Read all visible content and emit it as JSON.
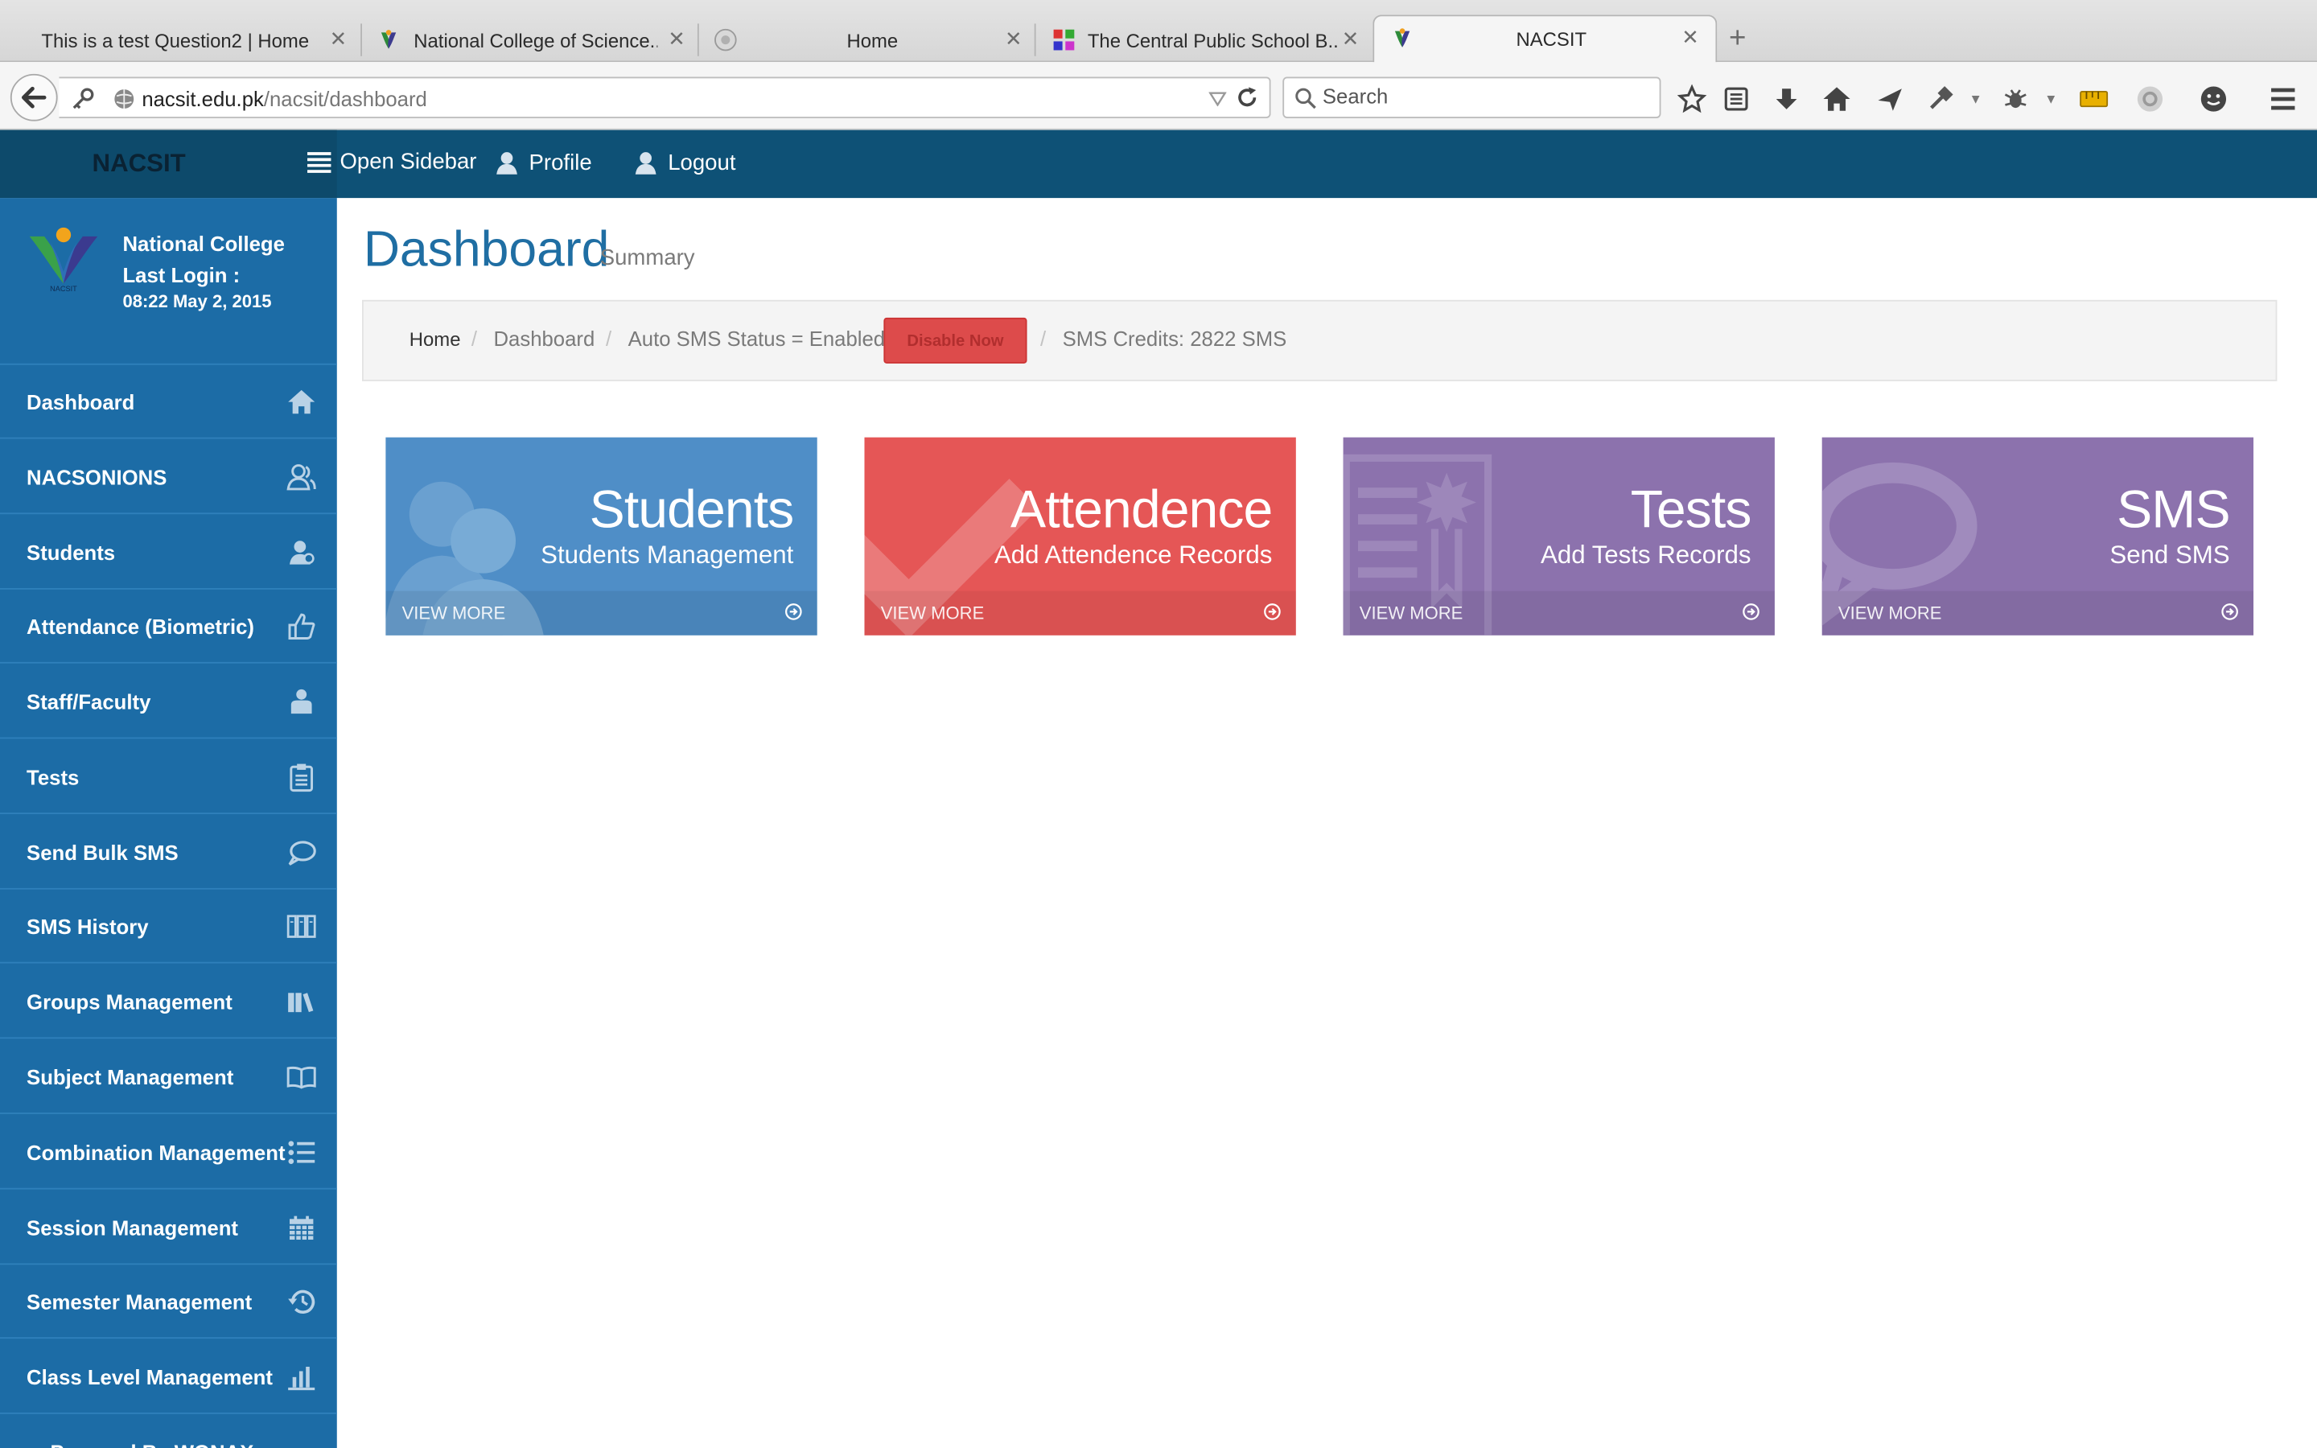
{
  "browser": {
    "tabs": [
      {
        "title": "This is a test Question2 | Home ..."
      },
      {
        "title": "National College of Science..."
      },
      {
        "title": "Home"
      },
      {
        "title": "The Central Public School B..."
      },
      {
        "title": "NACSIT"
      }
    ],
    "url_domain": "nacsit.edu.pk",
    "url_path": "/nacsit/dashboard",
    "search_placeholder": "Search"
  },
  "header": {
    "brand": "NACSIT",
    "nav": [
      {
        "label": "Open Sidebar",
        "icon": "menu-icon"
      },
      {
        "label": "Profile",
        "icon": "user-icon"
      },
      {
        "label": "Logout",
        "icon": "user-logout-icon"
      }
    ]
  },
  "sidebar": {
    "profile": {
      "name": "National College",
      "last_login_label": "Last Login :",
      "last_login_time": "08:22 May 2, 2015"
    },
    "items": [
      {
        "label": "Dashboard",
        "icon": "home-icon"
      },
      {
        "label": "NACSONIONS",
        "icon": "users-icon"
      },
      {
        "label": "Students",
        "icon": "student-icon"
      },
      {
        "label": "Attendance (Biometric)",
        "icon": "thumbs-up-icon"
      },
      {
        "label": "Staff/Faculty",
        "icon": "staff-icon"
      },
      {
        "label": "Tests",
        "icon": "clipboard-icon"
      },
      {
        "label": "Send Bulk SMS",
        "icon": "chat-bubble-icon"
      },
      {
        "label": "SMS History",
        "icon": "columns-icon"
      },
      {
        "label": "Groups Management",
        "icon": "books-icon"
      },
      {
        "label": "Subject Management",
        "icon": "open-book-icon"
      },
      {
        "label": "Combination Management",
        "icon": "list-icon"
      },
      {
        "label": "Session Management",
        "icon": "calendar-icon"
      },
      {
        "label": "Semester Management",
        "icon": "history-icon"
      },
      {
        "label": "Class Level Management",
        "icon": "bar-chart-icon"
      },
      {
        "label": "Powered By WONAX",
        "icon": ""
      }
    ]
  },
  "main": {
    "title": "Dashboard",
    "subtitle": "Summary",
    "breadcrumb": {
      "home": "Home",
      "dashboard": "Dashboard",
      "auto_sms": "Auto SMS Status = Enabled",
      "disable_button": "Disable Now",
      "credits": "SMS Credits: 2822 SMS"
    },
    "tiles": [
      {
        "title": "Students",
        "subtitle": "Students Management",
        "more": "VIEW MORE",
        "color": "#4f8ec7",
        "icon": "people-icon"
      },
      {
        "title": "Attendence",
        "subtitle": "Add Attendence Records",
        "more": "VIEW MORE",
        "color": "#e55656",
        "icon": "checkmark-icon"
      },
      {
        "title": "Tests",
        "subtitle": "Add Tests Records",
        "more": "VIEW MORE",
        "color": "#8c72ad",
        "icon": "certificate-icon"
      },
      {
        "title": "SMS",
        "subtitle": "Send SMS",
        "more": "VIEW MORE",
        "color": "#8c72ad",
        "icon": "speech-bubble-icon"
      }
    ]
  },
  "colors": {
    "header": "#0e5176",
    "sidebar": "#1c6ca6",
    "title": "#1f6ea3"
  }
}
